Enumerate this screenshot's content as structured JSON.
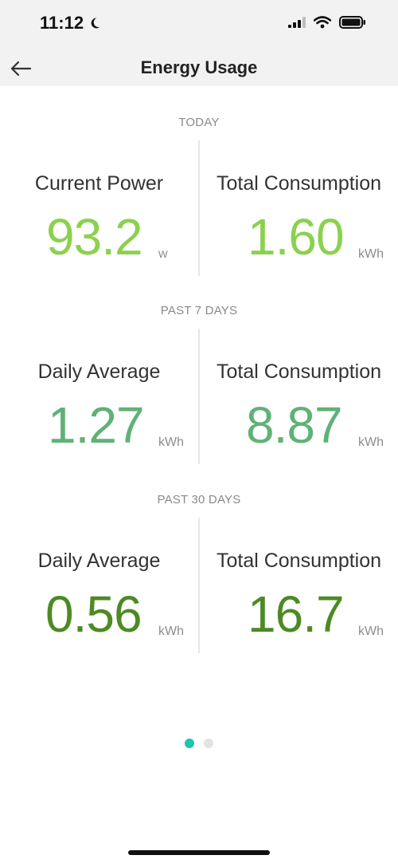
{
  "status_bar": {
    "time": "11:12"
  },
  "header": {
    "title": "Energy Usage"
  },
  "sections": [
    {
      "label": "TODAY",
      "left": {
        "label": "Current Power",
        "value": "93.2",
        "unit": "w"
      },
      "right": {
        "label": "Total Consumption",
        "value": "1.60",
        "unit": "kWh"
      }
    },
    {
      "label": "PAST 7 DAYS",
      "left": {
        "label": "Daily Average",
        "value": "1.27",
        "unit": "kWh"
      },
      "right": {
        "label": "Total Consumption",
        "value": "8.87",
        "unit": "kWh"
      }
    },
    {
      "label": "PAST 30 DAYS",
      "left": {
        "label": "Daily Average",
        "value": "0.56",
        "unit": "kWh"
      },
      "right": {
        "label": "Total Consumption",
        "value": "16.7",
        "unit": "kWh"
      }
    }
  ],
  "colors": {
    "today": "#8bd14e",
    "past7": "#5fb276",
    "past30": "#4e8a24",
    "page_dot_active": "#1fc4b0",
    "page_dot_inactive": "#e3e3e3"
  },
  "icons": {
    "back": "back-arrow-icon",
    "moon": "moon-icon",
    "signal": "signal-icon",
    "wifi": "wifi-icon",
    "battery": "battery-icon"
  },
  "pagination": {
    "count": 2,
    "active_index": 0
  }
}
